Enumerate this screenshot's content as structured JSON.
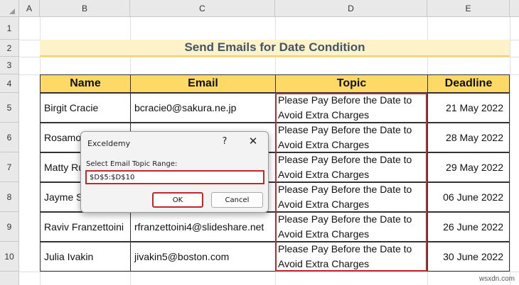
{
  "columns": [
    "A",
    "B",
    "C",
    "D",
    "E"
  ],
  "rows": [
    "1",
    "2",
    "3",
    "4",
    "5",
    "6",
    "7",
    "8",
    "9",
    "10"
  ],
  "title": "Send Emails for Date Condition",
  "headers": {
    "name": "Name",
    "email": "Email",
    "topic": "Topic",
    "deadline": "Deadline"
  },
  "records": [
    {
      "name": "Birgit Cracie",
      "email": "bcracie0@sakura.ne.jp",
      "topic": "Please Pay Before the Date to Avoid Extra Charges",
      "deadline": "21 May 2022"
    },
    {
      "name": "Rosamo",
      "email": "",
      "topic": "Please Pay Before the Date to Avoid Extra Charges",
      "deadline": "28 May 2022"
    },
    {
      "name": "Matty Ru",
      "email": "",
      "topic": "Please Pay Before the Date to Avoid Extra Charges",
      "deadline": "29 May 2022"
    },
    {
      "name": "Jayme Sc",
      "email": "",
      "topic": "Please Pay Before the Date to Avoid Extra Charges",
      "deadline": "06 June 2022"
    },
    {
      "name": "Raviv Franzettoini",
      "email": "rfranzettoini4@slideshare.net",
      "topic": "Please Pay Before the Date to Avoid Extra Charges",
      "deadline": "26 June 2022"
    },
    {
      "name": "Julia Ivakin",
      "email": "jivakin5@boston.com",
      "topic": "Please Pay Before the Date to Avoid Extra Charges",
      "deadline": "30 June 2022"
    }
  ],
  "dialog": {
    "title": "Exceldemy",
    "help": "?",
    "close": "✕",
    "label": "Select Email Topic Range:",
    "input_value": "$D$5:$D$10",
    "ok": "OK",
    "cancel": "Cancel"
  },
  "watermark": "wsxdn.com",
  "colors": {
    "header_fill": "#fed966",
    "title_fill": "#fdf2c8",
    "highlight": "#c0282d"
  }
}
